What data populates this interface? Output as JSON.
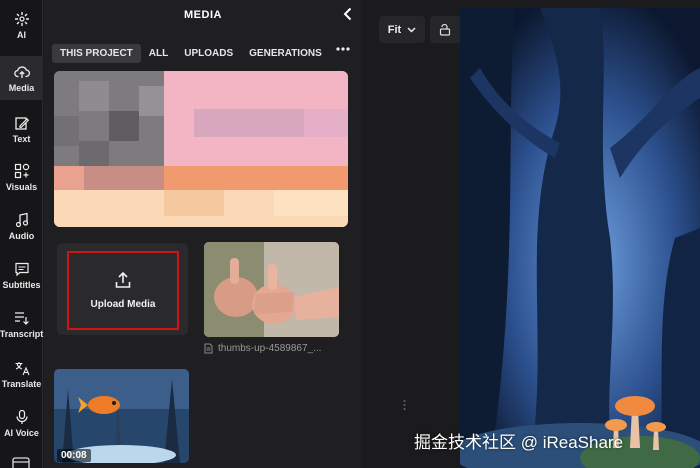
{
  "rail": {
    "items": [
      {
        "label": "AI",
        "icon": "sparkle-icon"
      },
      {
        "label": "Media",
        "icon": "upload-cloud-icon"
      },
      {
        "label": "Text",
        "icon": "edit-text-icon"
      },
      {
        "label": "Visuals",
        "icon": "grid-shapes-icon"
      },
      {
        "label": "Audio",
        "icon": "music-note-icon"
      },
      {
        "label": "Subtitles",
        "icon": "subtitles-icon"
      },
      {
        "label": "Transcript",
        "icon": "transcript-icon"
      },
      {
        "label": "Translate",
        "icon": "translate-icon"
      },
      {
        "label": "AI Voice",
        "icon": "voice-icon"
      }
    ]
  },
  "panel": {
    "title": "MEDIA",
    "tabs": [
      "THIS PROJECT",
      "ALL",
      "UPLOADS",
      "GENERATIONS"
    ],
    "upload_label": "Upload Media",
    "thumb_filename": "thumbs-up-4589867_...",
    "video_duration": "00:08"
  },
  "toolbar": {
    "fit_label": "Fit"
  },
  "watermark": "掘金技术社区 @ iReaShare",
  "colors": {
    "background": "#1b1b1d",
    "panel": "#1f1f21",
    "accent_red": "#d31313"
  }
}
